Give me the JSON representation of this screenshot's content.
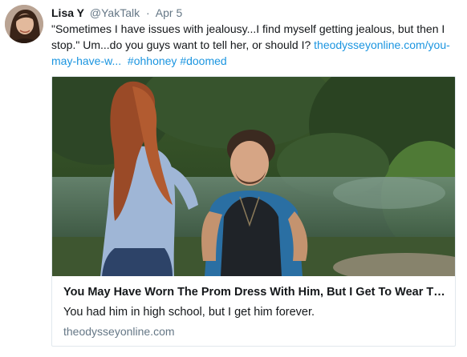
{
  "tweet": {
    "display_name": "Lisa Y",
    "handle": "@YakTalk",
    "separator": "·",
    "time": "Apr 5",
    "text": "\"Sometimes I have issues with jealousy...I find myself getting jealous, but then I stop.\" Um...do you guys want to tell her, or should I?  ",
    "link_text": "theodysseyonline.com/you-may-have-w...",
    "hashtags": [
      "#ohhoney",
      "#doomed"
    ]
  },
  "card": {
    "title": "You May Have Worn The Prom Dress With Him, But I Get To Wear The...",
    "description": "You had him in high school, but I get him forever.",
    "domain": "theodysseyonline.com"
  },
  "colors": {
    "link": "#1b95e0",
    "secondary_text": "#657786",
    "border": "#e1e8ed"
  }
}
